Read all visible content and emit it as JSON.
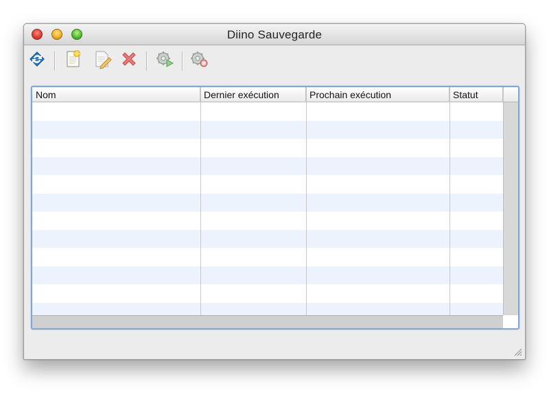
{
  "window": {
    "title": "Diino Sauvegarde"
  },
  "toolbar": {
    "buttons": [
      {
        "name": "sync-icon"
      },
      {
        "name": "new-document-icon"
      },
      {
        "name": "edit-document-icon"
      },
      {
        "name": "delete-icon"
      },
      {
        "name": "run-backup-icon"
      },
      {
        "name": "stop-backup-icon"
      }
    ]
  },
  "table": {
    "columns": [
      "Nom",
      "Dernier exécution",
      "Prochain exécution",
      "Statut"
    ],
    "rows": []
  },
  "colors": {
    "row_stripe": "#edf3fc",
    "focus_ring": "#7fa6d8",
    "close": "#e0443a",
    "minimize": "#f5b52b",
    "zoom": "#5fc43a"
  }
}
